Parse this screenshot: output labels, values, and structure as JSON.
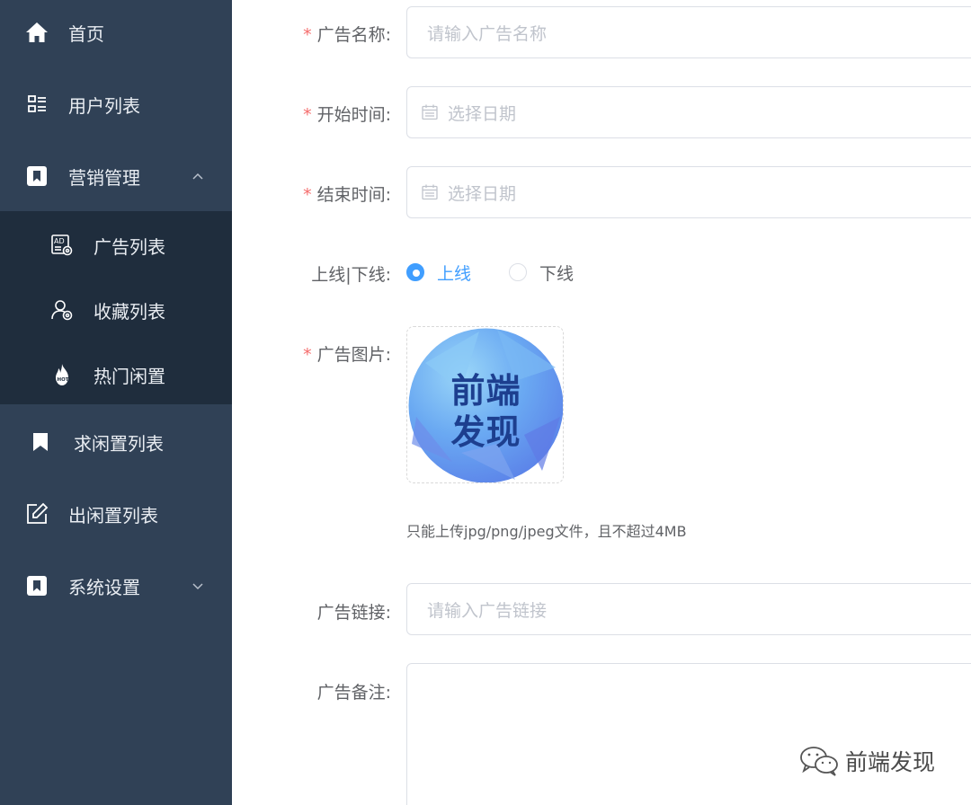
{
  "sidebar": {
    "items": [
      {
        "label": "首页",
        "icon": "home-icon"
      },
      {
        "label": "用户列表",
        "icon": "user-list-icon"
      },
      {
        "label": "营销管理",
        "icon": "marketing-icon",
        "expanded": true
      },
      {
        "label": "求闲置列表",
        "icon": "bookmark-icon"
      },
      {
        "label": "出闲置列表",
        "icon": "edit-icon"
      },
      {
        "label": "系统设置",
        "icon": "settings-icon",
        "expanded": false
      }
    ],
    "submenu": [
      {
        "label": "广告列表",
        "icon": "ad-icon"
      },
      {
        "label": "收藏列表",
        "icon": "user-gear-icon"
      },
      {
        "label": "热门闲置",
        "icon": "hot-fire-icon"
      }
    ]
  },
  "form": {
    "ad_name": {
      "label": "广告名称:",
      "placeholder": "请输入广告名称",
      "required": true
    },
    "start_time": {
      "label": "开始时间:",
      "placeholder": "选择日期",
      "required": true
    },
    "end_time": {
      "label": "结束时间:",
      "placeholder": "选择日期",
      "required": true
    },
    "online": {
      "label": "上线|下线:",
      "options": [
        "上线",
        "下线"
      ],
      "selected": "上线"
    },
    "image": {
      "label": "广告图片:",
      "required": true,
      "logo_line1": "前端",
      "logo_line2": "发现",
      "tip": "只能上传jpg/png/jpeg文件，且不超过4MB"
    },
    "link": {
      "label": "广告链接:",
      "placeholder": "请输入广告链接"
    },
    "remark": {
      "label": "广告备注:"
    },
    "required_mark": "*"
  },
  "watermark": {
    "text": "前端发现"
  },
  "colors": {
    "sidebar_bg": "#304156",
    "submenu_bg": "#1f2d3d",
    "primary": "#409eff",
    "required": "#f56c6c"
  }
}
